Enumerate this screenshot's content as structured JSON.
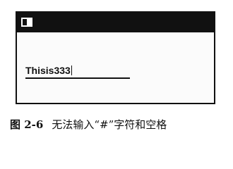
{
  "window": {
    "textfield": {
      "value": "Thisis333"
    }
  },
  "caption": {
    "number": "图 2-6",
    "text": "无法输入“#”字符和空格"
  },
  "icons": {
    "window_icon": "window-icon"
  }
}
